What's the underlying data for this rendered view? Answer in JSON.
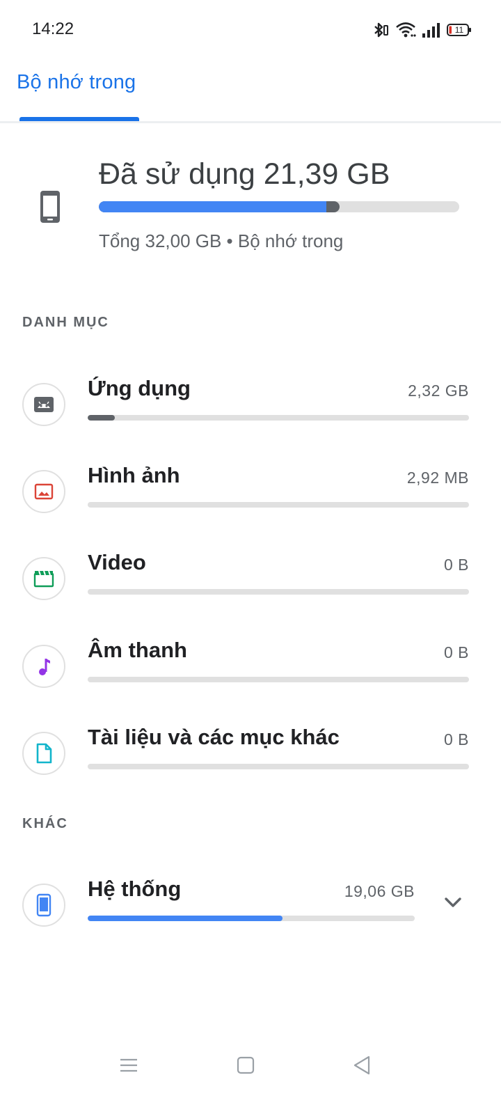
{
  "status_bar": {
    "time": "14:22",
    "battery_level": "11",
    "icons": [
      "bluetooth-icon",
      "wifi-icon",
      "signal-icon",
      "battery-icon"
    ]
  },
  "header": {
    "tab_label": "Bộ nhớ trong"
  },
  "summary": {
    "title": "Đã sử dụng 21,39 GB",
    "subtitle": "Tổng 32,00 GB • Bộ nhớ trong",
    "used_fraction": 0.668,
    "apps_fraction": 0.632,
    "icon": "phone-icon"
  },
  "categories_header": "DANH MỤC",
  "categories": [
    {
      "name": "Ứng dụng",
      "size": "2,32 GB",
      "fraction": 0.072,
      "color": "#5f6368",
      "icon": "android-icon"
    },
    {
      "name": "Hình ảnh",
      "size": "2,92 MB",
      "fraction": 0,
      "color": "#db4437",
      "icon": "image-icon"
    },
    {
      "name": "Video",
      "size": "0 B",
      "fraction": 0,
      "color": "#0f9d58",
      "icon": "video-icon"
    },
    {
      "name": "Âm thanh",
      "size": "0 B",
      "fraction": 0,
      "color": "#9334e6",
      "icon": "music-note-icon"
    },
    {
      "name": "Tài liệu và các mục khác",
      "size": "0 B",
      "fraction": 0,
      "color": "#12b5cb",
      "icon": "document-icon"
    }
  ],
  "other_header": "KHÁC",
  "system": {
    "name": "Hệ thống",
    "size": "19,06 GB",
    "fraction": 0.596,
    "color": "#4285f4",
    "icon": "phone-icon"
  },
  "colors": {
    "accent": "#1a73e8",
    "bar_blue": "#4285f4",
    "bar_track": "#e0e0e0"
  }
}
